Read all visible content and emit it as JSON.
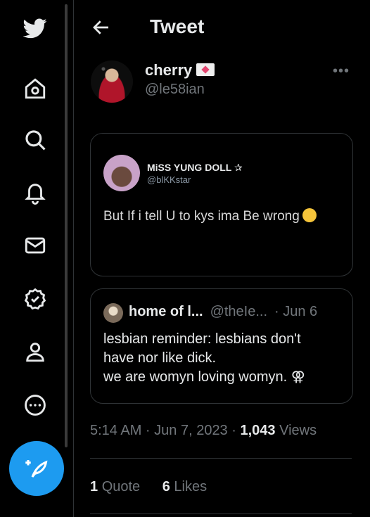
{
  "sidebar": {
    "items": [
      {
        "name": "twitter-bird-icon"
      },
      {
        "name": "home-icon"
      },
      {
        "name": "search-icon"
      },
      {
        "name": "notifications-bell-icon"
      },
      {
        "name": "messages-envelope-icon"
      },
      {
        "name": "verified-badge-icon"
      },
      {
        "name": "profile-person-icon"
      },
      {
        "name": "more-circle-icon"
      }
    ],
    "compose_icon": "compose-tweet-icon"
  },
  "header": {
    "title": "Tweet",
    "back_icon": "back-arrow-icon"
  },
  "tweet": {
    "author_name": "cherry",
    "author_emoji": "💌",
    "author_handle": "@le58ian",
    "more_label": "•••",
    "media": {
      "name": "MiSS YUNG DOLL",
      "name_suffix": "✰",
      "handle": "@blKKstar",
      "text": "But If i tell U to kys ima Be wrong"
    },
    "quote": {
      "name": "home of l...",
      "handle": "@theIe...",
      "date": "· Jun 6",
      "lines": [
        "lesbian reminder: lesbians don't",
        "have nor like dick.",
        "we are womyn loving womyn. ⚢"
      ]
    },
    "meta": {
      "time": "5:14 AM · Jun 7, 2023 ·",
      "views_count": "1,043",
      "views_label": "Views"
    },
    "stats": {
      "quote_count": "1",
      "quote_label": "Quote",
      "likes_count": "6",
      "likes_label": "Likes"
    }
  },
  "colors": {
    "accent": "#1d9bf0",
    "background": "#000000",
    "text": "#e7e9ea",
    "muted": "#71767b",
    "border": "#2f3336"
  }
}
